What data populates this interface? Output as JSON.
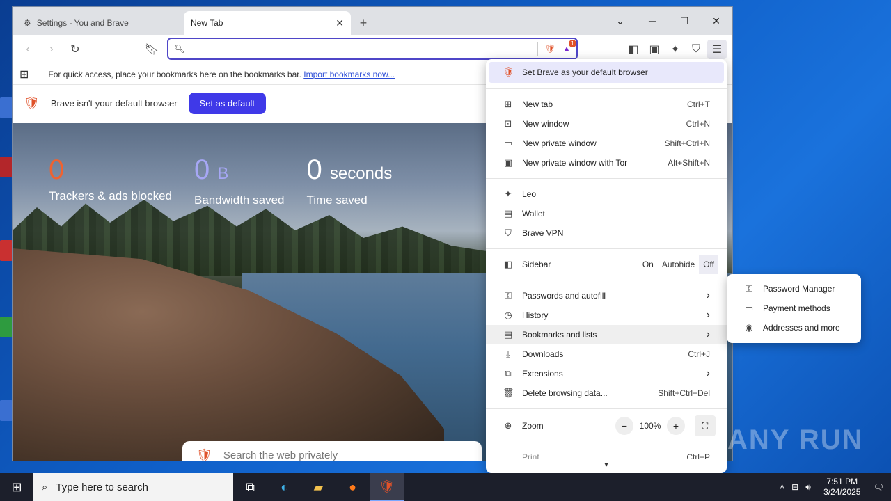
{
  "tabs": [
    {
      "title": "Settings - You and Brave",
      "active": false
    },
    {
      "title": "New Tab",
      "active": true
    }
  ],
  "omnibox": {
    "placeholder": "",
    "badge_count": "1"
  },
  "bookmarks_bar": {
    "text": "For quick access, place your bookmarks here on the bookmarks bar.",
    "link": "Import bookmarks now..."
  },
  "infobar": {
    "text": "Brave isn't your default browser",
    "button": "Set as default"
  },
  "stats": [
    {
      "value": "0",
      "unit": "",
      "label": "Trackers & ads blocked"
    },
    {
      "value": "0",
      "unit": "B",
      "label": "Bandwidth saved"
    },
    {
      "value": "0",
      "unit": "seconds",
      "label": "Time saved"
    }
  ],
  "ntp_search": {
    "placeholder": "Search the web privately"
  },
  "menu": {
    "default_browser": "Set Brave as your default browser",
    "group1": [
      {
        "label": "New tab",
        "shortcut": "Ctrl+T",
        "icon": "new-tab-icon"
      },
      {
        "label": "New window",
        "shortcut": "Ctrl+N",
        "icon": "new-window-icon"
      },
      {
        "label": "New private window",
        "shortcut": "Shift+Ctrl+N",
        "icon": "private-window-icon"
      },
      {
        "label": "New private window with Tor",
        "shortcut": "Alt+Shift+N",
        "icon": "tor-window-icon"
      }
    ],
    "group2": [
      {
        "label": "Leo",
        "icon": "leo-icon"
      },
      {
        "label": "Wallet",
        "icon": "wallet-icon"
      },
      {
        "label": "Brave VPN",
        "icon": "vpn-icon"
      }
    ],
    "sidebar": {
      "label": "Sidebar",
      "options": [
        "On",
        "Autohide",
        "Off"
      ],
      "selected": "Off"
    },
    "group3": [
      {
        "label": "Passwords and autofill",
        "shortcut": "",
        "submenu": true
      },
      {
        "label": "History",
        "shortcut": "",
        "submenu": true
      },
      {
        "label": "Bookmarks and lists",
        "shortcut": "",
        "submenu": true
      },
      {
        "label": "Downloads",
        "shortcut": "Ctrl+J",
        "submenu": false
      },
      {
        "label": "Extensions",
        "shortcut": "",
        "submenu": true
      },
      {
        "label": "Delete browsing data...",
        "shortcut": "Shift+Ctrl+Del",
        "submenu": false
      }
    ],
    "zoom": {
      "label": "Zoom",
      "value": "100%"
    },
    "partial": {
      "label": "Print...",
      "shortcut": "Ctrl+P"
    }
  },
  "submenu": [
    {
      "label": "Password Manager",
      "icon": "key-icon"
    },
    {
      "label": "Payment methods",
      "icon": "card-icon"
    },
    {
      "label": "Addresses and more",
      "icon": "location-pin-icon"
    }
  ],
  "taskbar": {
    "search_placeholder": "Type here to search",
    "time": "7:51 PM",
    "date": "3/24/2025"
  },
  "watermark": "ANY RUN",
  "colors": {
    "accent": "#3f39e8",
    "trackers": "#f0622f",
    "bandwidth": "#a6a7f5"
  }
}
